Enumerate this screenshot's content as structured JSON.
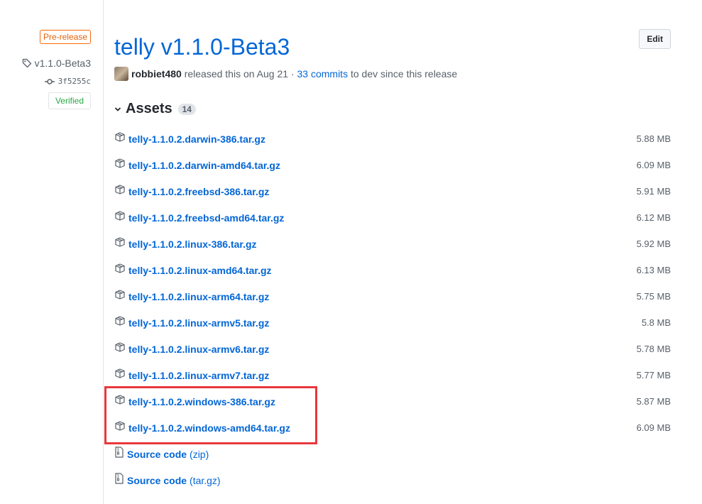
{
  "sidebar": {
    "prerelease_label": "Pre-release",
    "tag_label": "v1.1.0-Beta3",
    "commit_hash": "3f5255c",
    "verified_label": "Verified"
  },
  "release": {
    "title": "telly v1.1.0-Beta3",
    "edit_label": "Edit",
    "author": "robbiet480",
    "released_text": "released this on Aug 21",
    "separator": "·",
    "commits_link": "33 commits",
    "branch_text": "to dev since this release"
  },
  "assets": {
    "heading": "Assets",
    "count": "14",
    "files": [
      {
        "name": "telly-1.1.0.2.darwin-386.tar.gz",
        "size": "5.88 MB"
      },
      {
        "name": "telly-1.1.0.2.darwin-amd64.tar.gz",
        "size": "6.09 MB"
      },
      {
        "name": "telly-1.1.0.2.freebsd-386.tar.gz",
        "size": "5.91 MB"
      },
      {
        "name": "telly-1.1.0.2.freebsd-amd64.tar.gz",
        "size": "6.12 MB"
      },
      {
        "name": "telly-1.1.0.2.linux-386.tar.gz",
        "size": "5.92 MB"
      },
      {
        "name": "telly-1.1.0.2.linux-amd64.tar.gz",
        "size": "6.13 MB"
      },
      {
        "name": "telly-1.1.0.2.linux-arm64.tar.gz",
        "size": "5.75 MB"
      },
      {
        "name": "telly-1.1.0.2.linux-armv5.tar.gz",
        "size": "5.8 MB"
      },
      {
        "name": "telly-1.1.0.2.linux-armv6.tar.gz",
        "size": "5.78 MB"
      },
      {
        "name": "telly-1.1.0.2.linux-armv7.tar.gz",
        "size": "5.77 MB"
      },
      {
        "name": "telly-1.1.0.2.windows-386.tar.gz",
        "size": "5.87 MB"
      },
      {
        "name": "telly-1.1.0.2.windows-amd64.tar.gz",
        "size": "6.09 MB"
      }
    ],
    "source": [
      {
        "name": "Source code",
        "ext": "(zip)"
      },
      {
        "name": "Source code",
        "ext": "(tar.gz)"
      }
    ]
  },
  "icons": {
    "package": "package-icon",
    "zip": "file-zip-icon",
    "tag": "tag-icon",
    "commit": "git-commit-icon",
    "chevron": "chevron-down-icon"
  },
  "colors": {
    "link": "#0366d6",
    "prerelease": "#e36209",
    "verified": "#28a745",
    "highlight": "#e8383d"
  }
}
